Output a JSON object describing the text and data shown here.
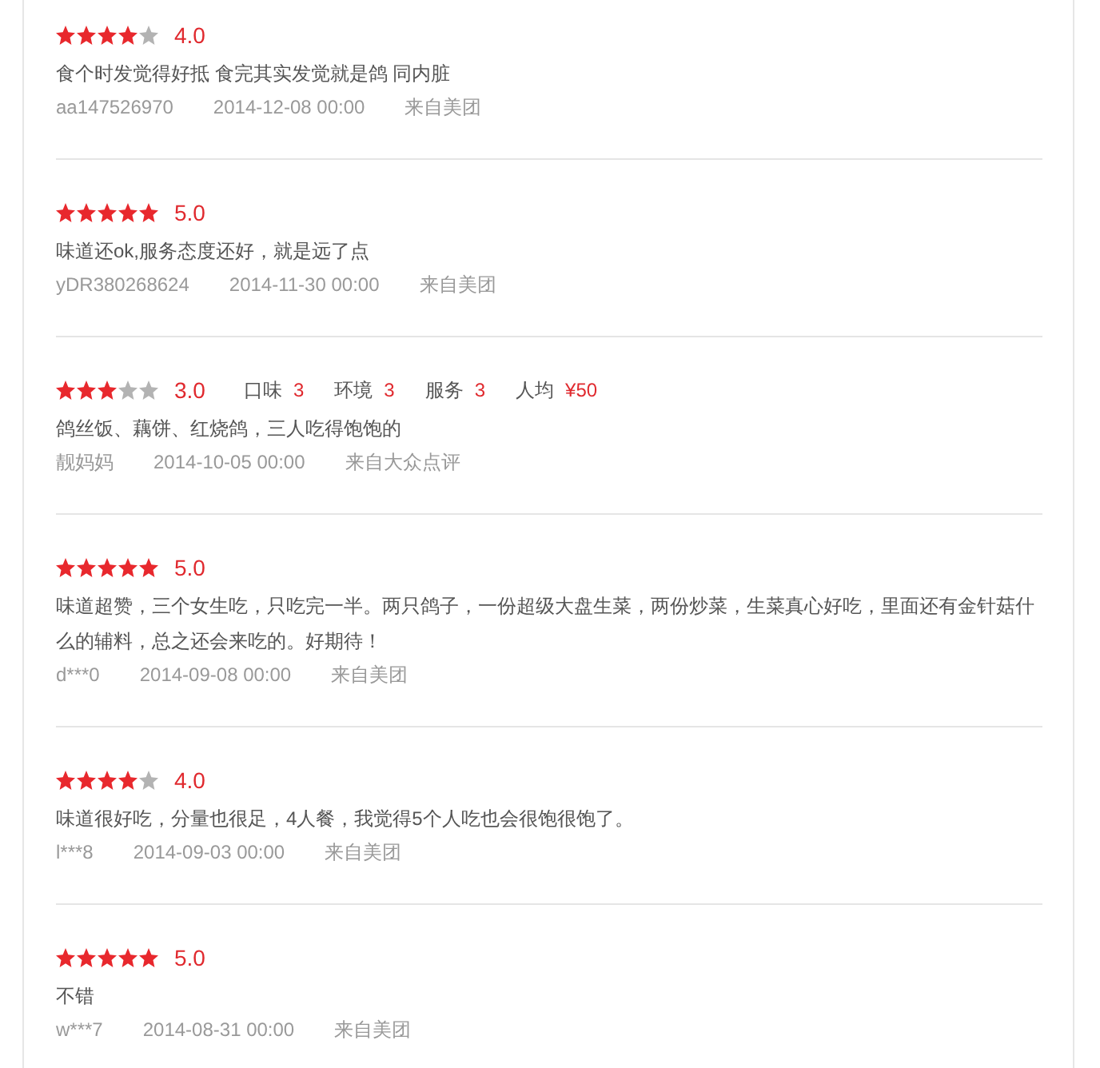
{
  "reviews": [
    {
      "stars": 4,
      "score": "4.0",
      "content": "食个时发觉得好抵 食完其实发觉就是鸽 同内脏",
      "user": "aa147526970",
      "time": "2014-12-08 00:00",
      "source": "来自美团"
    },
    {
      "stars": 5,
      "score": "5.0",
      "content": "味道还ok,服务态度还好，就是远了点",
      "user": "yDR380268624",
      "time": "2014-11-30 00:00",
      "source": "来自美团"
    },
    {
      "stars": 3,
      "score": "3.0",
      "sub_ratings": [
        {
          "label": "口味",
          "value": "3"
        },
        {
          "label": "环境",
          "value": "3"
        },
        {
          "label": "服务",
          "value": "3"
        },
        {
          "label": "人均",
          "value": "¥50"
        }
      ],
      "content": "鸽丝饭、藕饼、红烧鸽，三人吃得饱饱的",
      "user": "靓妈妈",
      "time": "2014-10-05 00:00",
      "source": "来自大众点评"
    },
    {
      "stars": 5,
      "score": "5.0",
      "content": "味道超赞，三个女生吃，只吃完一半。两只鸽子，一份超级大盘生菜，两份炒菜，生菜真心好吃，里面还有金针菇什么的辅料，总之还会来吃的。好期待！",
      "user": "d***0",
      "time": "2014-09-08 00:00",
      "source": "来自美团"
    },
    {
      "stars": 4,
      "score": "4.0",
      "content": "味道很好吃，分量也很足，4人餐，我觉得5个人吃也会很饱很饱了。",
      "user": "l***8",
      "time": "2014-09-03 00:00",
      "source": "来自美团"
    },
    {
      "stars": 5,
      "score": "5.0",
      "content": "不错",
      "user": "w***7",
      "time": "2014-08-31 00:00",
      "source": "来自美团"
    }
  ]
}
